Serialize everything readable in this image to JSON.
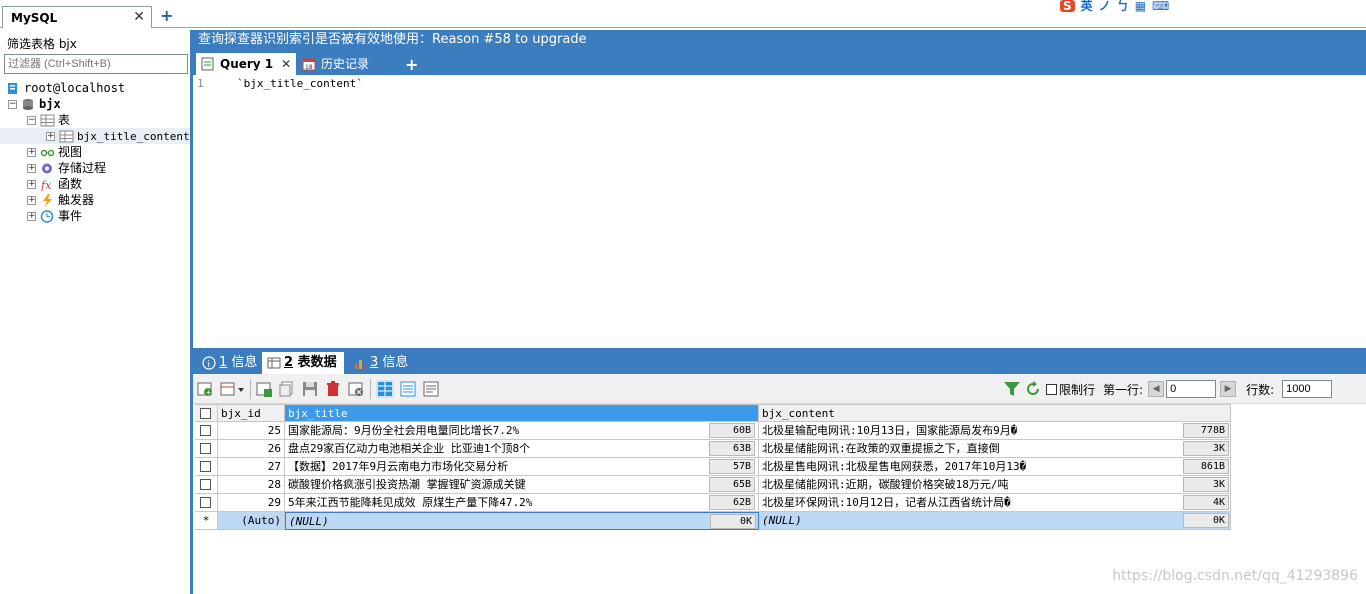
{
  "window": {
    "connection_tab": "MySQL",
    "close_glyph": "✕",
    "add_glyph": "+"
  },
  "ime": [
    "S",
    "英",
    "ノ",
    "ㄅ",
    "▦",
    "⌨"
  ],
  "sidebar": {
    "filter_label": "筛选表格 bjx",
    "filter_placeholder": "过滤器 (Ctrl+Shift+B)",
    "tree": {
      "host": "root@localhost",
      "database": "bjx",
      "tables_folder": "表",
      "table": "bjx_title_content",
      "folders": [
        "视图",
        "存储过程",
        "函数",
        "触发器",
        "事件"
      ]
    }
  },
  "main": {
    "hint": "查询探查器识别索引是否被有效地使用：Reason #58 to upgrade",
    "query_tabs": [
      {
        "label": "Query 1",
        "close": "✕"
      },
      {
        "label": "历史记录"
      }
    ],
    "editor": {
      "line_number": "1",
      "code": "`bjx_title_content`"
    },
    "result_tabs": [
      {
        "num": "1",
        "label": "信息"
      },
      {
        "num": "2",
        "label": "表数据"
      },
      {
        "num": "3",
        "label": "信息"
      }
    ],
    "toolbar": {
      "limit_label": "限制行",
      "first_row_label": "第一行:",
      "first_row_value": "0",
      "rows_label": "行数:",
      "rows_value": "1000"
    },
    "grid": {
      "columns": [
        "bjx_id",
        "bjx_title",
        "bjx_content"
      ],
      "rows": [
        {
          "id": "25",
          "title": "国家能源局：9月份全社会用电量同比增长7.2%",
          "title_size": "60B",
          "content": "北极星输配电网讯:10月13日，国家能源局发布9月�",
          "content_size": "778B"
        },
        {
          "id": "26",
          "title": "盘点29家百亿动力电池相关企业 比亚迪1个顶8个",
          "title_size": "63B",
          "content": "北极星储能网讯:在政策的双重提振之下，直接倒",
          "content_size": "3K"
        },
        {
          "id": "27",
          "title": "【数据】2017年9月云南电力市场化交易分析",
          "title_size": "57B",
          "content": "北极星售电网讯:北极星售电网获悉，2017年10月13�",
          "content_size": "861B"
        },
        {
          "id": "28",
          "title": "碳酸锂价格疯涨引投资热潮 掌握锂矿资源成关键",
          "title_size": "65B",
          "content": "北极星储能网讯:近期，碳酸锂价格突破18万元/吨",
          "content_size": "3K"
        },
        {
          "id": "29",
          "title": "5年来江西节能降耗见成效 原煤生产量下降47.2%",
          "title_size": "62B",
          "content": "北极星环保网讯:10月12日，记者从江西省统计局�",
          "content_size": "4K"
        }
      ],
      "new_row": {
        "marker": "*",
        "id": "(Auto)",
        "title": "(NULL)",
        "title_size": "0K",
        "content": "(NULL)",
        "content_size": "0K"
      }
    }
  },
  "watermark": "https://blog.csdn.net/qq_41293896"
}
